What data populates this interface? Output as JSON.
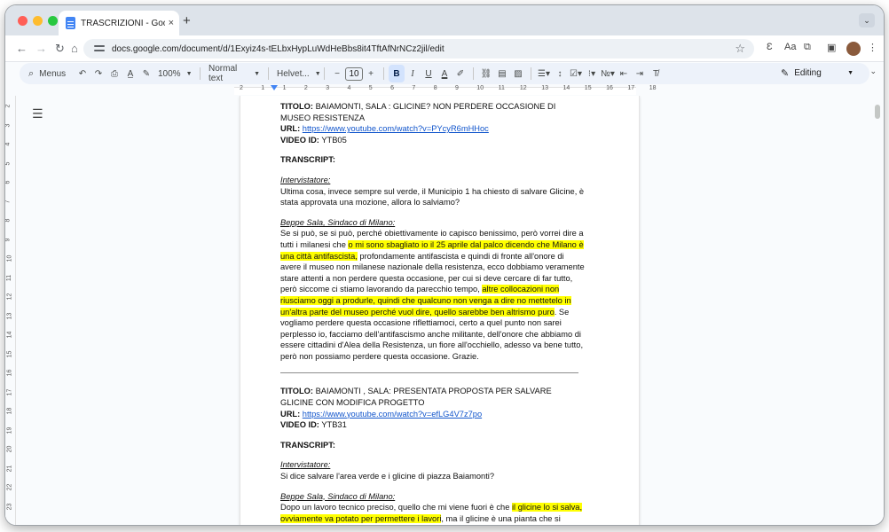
{
  "browser": {
    "tab_title": "TRASCRIZIONI - Google Docs",
    "tab_close": "×",
    "new_tab": "+",
    "url": "docs.google.com/document/d/1Exyiz4s-tELbxHypLuWdHeBbs8it4TftAfNrNCz2jil/edit",
    "tab_menu": "⌄"
  },
  "toolbar": {
    "menus_label": "Menus",
    "zoom": "100%",
    "style": "Normal text",
    "font": "Helvet...",
    "font_size": "10",
    "mode": "Editing"
  },
  "ruler": {
    "numbers": [
      "2",
      "1",
      "1",
      "2",
      "3",
      "4",
      "5",
      "6",
      "7",
      "8",
      "9",
      "10",
      "11",
      "12",
      "13",
      "14",
      "15",
      "16",
      "17",
      "18"
    ],
    "vnumbers": [
      "2",
      "3",
      "4",
      "5",
      "6",
      "7",
      "8",
      "9",
      "10",
      "11",
      "12",
      "13",
      "14",
      "15",
      "16",
      "17",
      "18",
      "19",
      "20",
      "21",
      "22",
      "23"
    ]
  },
  "doc": {
    "e1": {
      "title_label": "TITOLO:",
      "title": " BAIAMONTI, SALA : GLICINE? NON PERDERE OCCASIONE DI MUSEO RESISTENZA",
      "url_label": "URL:",
      "url": "https://www.youtube.com/watch?v=PYcyR6mHHoc",
      "video_label": "VIDEO ID:",
      "video_id": " YTB05",
      "transcript_label": "TRANSCRIPT:",
      "speaker1": "Intervistatore:",
      "q1": "Ultima cosa, invece sempre sul verde, il Municipio 1 ha chiesto di salvare Glicine, è stata approvata una mozione, allora lo salviamo?",
      "speaker2": "Beppe Sala, Sindaco di Milano:",
      "a1_t1": "Se si può, se si può, perché obiettivamente io capisco benissimo, però vorrei dire a tutti i milanesi che ",
      "a1_h1": "o mi sono sbagliato io il 25 aprile dal palco dicendo che Milano è una città antifascista,",
      "a1_t2": " profondamente antifascista e quindi di fronte all'onore di avere il museo non milanese nazionale della resistenza, ecco dobbiamo veramente stare attenti a non perdere questa occasione, per cui si deve cercare di far tutto, però siccome ci stiamo lavorando da parecchio tempo, ",
      "a1_h2": "altre collocazioni non riusciamo oggi a produrle, quindi che qualcuno non venga a dire no mettetelo in un'altra parte del museo perché vuol dire, quello sarebbe ben altrismo puro",
      "a1_t3": ". Se vogliamo perdere questa occasione riflettiamoci, certo a quel punto non sarei perplesso io, facciamo dell'antifascismo anche militante, dell'onore che abbiamo di essere cittadini d'Alea della Resistenza, un fiore all'occhiello, adesso va bene tutto, però non possiamo perdere questa occasione. Grazie."
    },
    "e2": {
      "title_label": "TITOLO:",
      "title": " BAIAMONTI , SALA: PRESENTATA PROPOSTA PER SALVARE GLICINE CON MODIFICA PROGETTO",
      "url_label": "URL:",
      "url": "https://www.youtube.com/watch?v=efLG4V7z7po",
      "video_label": "VIDEO ID:",
      "video_id": " YTB31",
      "transcript_label": "TRANSCRIPT:",
      "speaker1": "Intervistatore:",
      "q1": "Si dice salvare l'area verde e i glicine di piazza Baiamonti?",
      "speaker2": "Beppe Sala, Sindaco di Milano:",
      "a1_t1": "Dopo un lavoro tecnico preciso, quello che mi viene fuori è che ",
      "a1_h1": "il glicine lo si salva, ovviamente va potato per permettere i lavori",
      "a1_t2": ", ma il glicine è una pianta che si sviluppa molto rapidamente, quindi in un paio di anni sarà come prima. La stessa cosa non si può dire per i tigli, ma su due certamente li salveremo. Poi ci sono altri due tigli e un bagolaro"
    }
  }
}
